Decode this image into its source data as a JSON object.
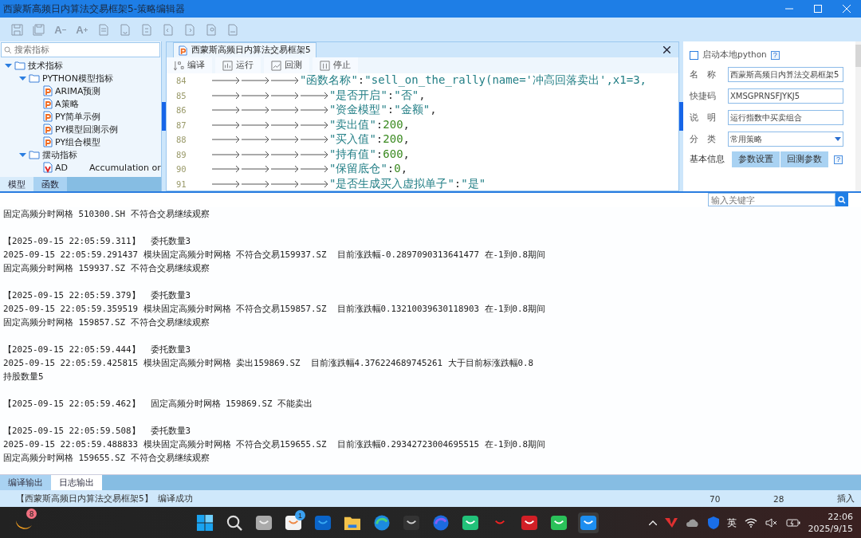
{
  "window": {
    "title": "西蒙斯高频日内算法交易框架5-策略编辑器"
  },
  "toolbar": [
    {
      "kind": "save"
    },
    {
      "kind": "save_all"
    },
    {
      "kind": "font_smaller",
      "label": "A"
    },
    {
      "kind": "font_larger",
      "label": "A"
    },
    {
      "kind": "doc"
    },
    {
      "kind": "doc"
    },
    {
      "kind": "doc"
    },
    {
      "kind": "doc"
    },
    {
      "kind": "doc"
    },
    {
      "kind": "doc"
    },
    {
      "kind": "doc"
    }
  ],
  "sidebar": {
    "search": {
      "placeholder": "搜索指标"
    },
    "tree": [
      {
        "label": "技术指标",
        "kind": "folder",
        "expanded": true,
        "children": [
          {
            "label": "PYTHON模型指标",
            "kind": "folder",
            "expanded": true,
            "children": [
              {
                "label": "ARIMA预测",
                "kind": "python"
              },
              {
                "label": "A策略",
                "kind": "python"
              },
              {
                "label": "PY简单示例",
                "kind": "python"
              },
              {
                "label": "PY模型回测示例",
                "kind": "python"
              },
              {
                "label": "PY组合模型",
                "kind": "python"
              }
            ]
          },
          {
            "label": "摆动指标",
            "kind": "folder",
            "expanded": true,
            "children": [
              {
                "label": "AD",
                "kind": "formula",
                "description": "Accumulation or"
              }
            ]
          }
        ]
      }
    ],
    "tabs": [
      {
        "label": "模型",
        "selected": true
      },
      {
        "label": "函数",
        "selected": false
      }
    ]
  },
  "editor": {
    "tab": {
      "title": "西蒙斯高频日内算法交易框架5"
    },
    "toolbar": [
      {
        "label": "编译",
        "kind": "compile"
      },
      {
        "label": "运行",
        "kind": "run"
      },
      {
        "label": "回测",
        "kind": "backtest"
      },
      {
        "label": "停止",
        "kind": "stop"
      }
    ],
    "lines": [
      {
        "number": "84",
        "text": "\t\t\t\"函数名称\":\"sell_on_the_rally(name='冲高回落卖出',x1=3,"
      },
      {
        "number": "85",
        "text": "\t\t\t\t\"是否开启\":\"否\","
      },
      {
        "number": "86",
        "text": "\t\t\t\t\"资金模型\":\"金额\","
      },
      {
        "number": "87",
        "text": "\t\t\t\t\"卖出值\":200,"
      },
      {
        "number": "88",
        "text": "\t\t\t\t\"买入值\":200,"
      },
      {
        "number": "89",
        "text": "\t\t\t\t\"持有值\":600,"
      },
      {
        "number": "90",
        "text": "\t\t\t\t\"保留底仓\":0,"
      },
      {
        "number": "91",
        "text": "\t\t\t\t\"是否生成买入虚拟单子\":\"是\""
      }
    ]
  },
  "properties": {
    "local_python": {
      "label": "启动本地python",
      "checked": false,
      "help": "?"
    },
    "fields": [
      {
        "label": "名　称",
        "value": "西蒙斯高频日内算法交易框架5",
        "kind": "text"
      },
      {
        "label": "快捷码",
        "value": "XMSGPRNSFJYKJ5",
        "kind": "text"
      },
      {
        "label": "说　明",
        "value": "运行指数中买卖组合",
        "kind": "text"
      },
      {
        "label": "分　类",
        "value": "常用策略",
        "kind": "dropdown"
      }
    ],
    "tabs": [
      {
        "label": "基本信息",
        "selected": true
      },
      {
        "label": "参数设置",
        "selected": false
      },
      {
        "label": "回测参数",
        "selected": false
      }
    ],
    "tabs_help": "?"
  },
  "log": {
    "search": {
      "placeholder": "输入关键字"
    },
    "blocks": [
      [
        "固定高频分时网格 510300.SH 不符合交易继续观察"
      ],
      [
        "【2025-09-15 22:05:59.311】  委托数量3",
        "2025-09-15 22:05:59.291437 模块固定高频分时网格 不符合交易159937.SZ  目前涨跌幅-0.2897090313641477 在-1到0.8期间",
        "固定高频分时网格 159937.SZ 不符合交易继续观察"
      ],
      [
        "【2025-09-15 22:05:59.379】  委托数量3",
        "2025-09-15 22:05:59.359519 模块固定高频分时网格 不符合交易159857.SZ  目前涨跌幅0.13210039630118903 在-1到0.8期间",
        "固定高频分时网格 159857.SZ 不符合交易继续观察"
      ],
      [
        "【2025-09-15 22:05:59.444】  委托数量3",
        "2025-09-15 22:05:59.425815 模块固定高频分时网格 卖出159869.SZ  目前涨跌幅4.376224689745261 大于目前标涨跌幅0.8",
        "持股数量5"
      ],
      [
        "【2025-09-15 22:05:59.462】  固定高频分时网格 159869.SZ 不能卖出"
      ],
      [
        "【2025-09-15 22:05:59.508】  委托数量3",
        "2025-09-15 22:05:59.488833 模块固定高频分时网格 不符合交易159655.SZ  目前涨跌幅0.29342723004695515 在-1到0.8期间",
        "固定高频分时网格 159655.SZ 不符合交易继续观察"
      ]
    ],
    "tabs": [
      {
        "label": "编译输出",
        "selected": false
      },
      {
        "label": "日志输出",
        "selected": true
      }
    ]
  },
  "status_bar": {
    "message": "【西蒙斯高频日内算法交易框架5】  编译成功",
    "line": "70",
    "column": "28",
    "mode": "插入"
  },
  "taskbar": {
    "widget": {
      "badge": "8"
    },
    "apps": [
      {
        "kind": "windows"
      },
      {
        "kind": "search"
      },
      {
        "kind": "taskview"
      },
      {
        "kind": "store",
        "badge": "1"
      },
      {
        "kind": "mail"
      },
      {
        "kind": "folder"
      },
      {
        "kind": "browser"
      },
      {
        "kind": "cube"
      },
      {
        "kind": "browser_ai"
      },
      {
        "kind": "bag"
      },
      {
        "kind": "office"
      },
      {
        "kind": "red"
      },
      {
        "kind": "chat"
      },
      {
        "kind": "trading",
        "selected": true
      }
    ],
    "tray": {
      "ime": "英",
      "time": "22:06",
      "date": "2025/9/15"
    }
  }
}
